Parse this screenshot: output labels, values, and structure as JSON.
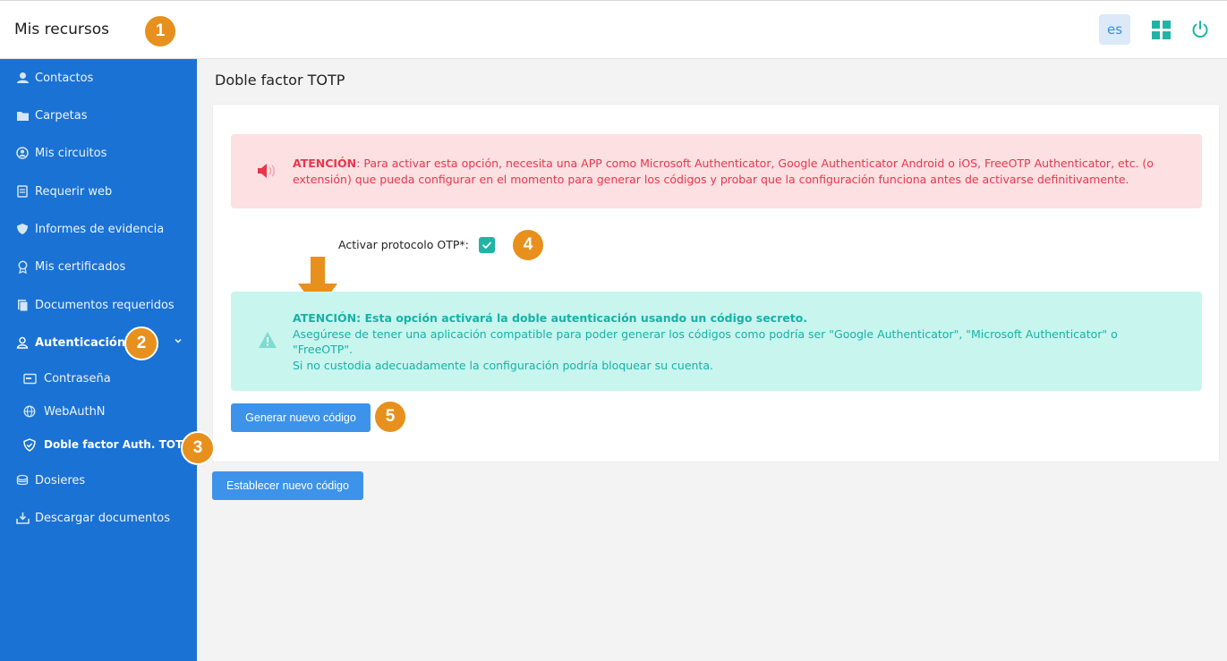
{
  "header": {
    "title": "Mis recursos",
    "language": "es",
    "accent_color": "#1fb4a6"
  },
  "markers": {
    "m1": "1",
    "m2": "2",
    "m3": "3",
    "m4": "4",
    "m5": "5",
    "color": "#e8901d"
  },
  "sidebar": {
    "background": "#1a72d4",
    "items": [
      {
        "label": "Contactos",
        "icon": "contacts-icon"
      },
      {
        "label": "Carpetas",
        "icon": "folder-icon"
      },
      {
        "label": "Mis circuitos",
        "icon": "circuit-icon"
      },
      {
        "label": "Requerir web",
        "icon": "web-form-icon"
      },
      {
        "label": "Informes de evidencia",
        "icon": "evidence-icon"
      },
      {
        "label": "Mis certificados",
        "icon": "certificate-icon"
      },
      {
        "label": "Documentos requeridos",
        "icon": "documents-icon"
      },
      {
        "label": "Autenticación",
        "icon": "user-icon"
      },
      {
        "label": "Contraseña",
        "icon": "password-icon"
      },
      {
        "label": "WebAuthN",
        "icon": "globe-icon"
      },
      {
        "label": "Doble factor Auth. TOTP",
        "icon": "shield-check-icon"
      },
      {
        "label": "Dosieres",
        "icon": "dossier-icon"
      },
      {
        "label": "Descargar documentos",
        "icon": "download-icon"
      }
    ]
  },
  "main": {
    "title": "Doble factor TOTP",
    "alert_red": {
      "prefix": "ATENCIÓN",
      "text": ": Para activar esta opción, necesita una APP como Microsoft Authenticator, Google Authenticator Android o iOS, FreeOTP Authenticator, etc. (o extensión) que pueda configurar en el momento para generar los códigos y probar que la configuración funciona antes de activarse definitivamente."
    },
    "otp_label": "Activar protocolo OTP*:",
    "otp_checked": true,
    "alert_teal": {
      "heading": "ATENCIÓN: Esta opción activará la doble autenticación usando un código secreto.",
      "line1": "Asegúrese de tener una aplicación compatible para poder generar los códigos como podría ser \"Google Authenticator\", \"Microsoft Authenticator\" o \"FreeOTP\".",
      "line2": "Si no custodia adecuadamente la configuración podría bloquear su cuenta."
    },
    "generate_button": "Generar nuevo código",
    "set_button": "Establecer nuevo código"
  }
}
